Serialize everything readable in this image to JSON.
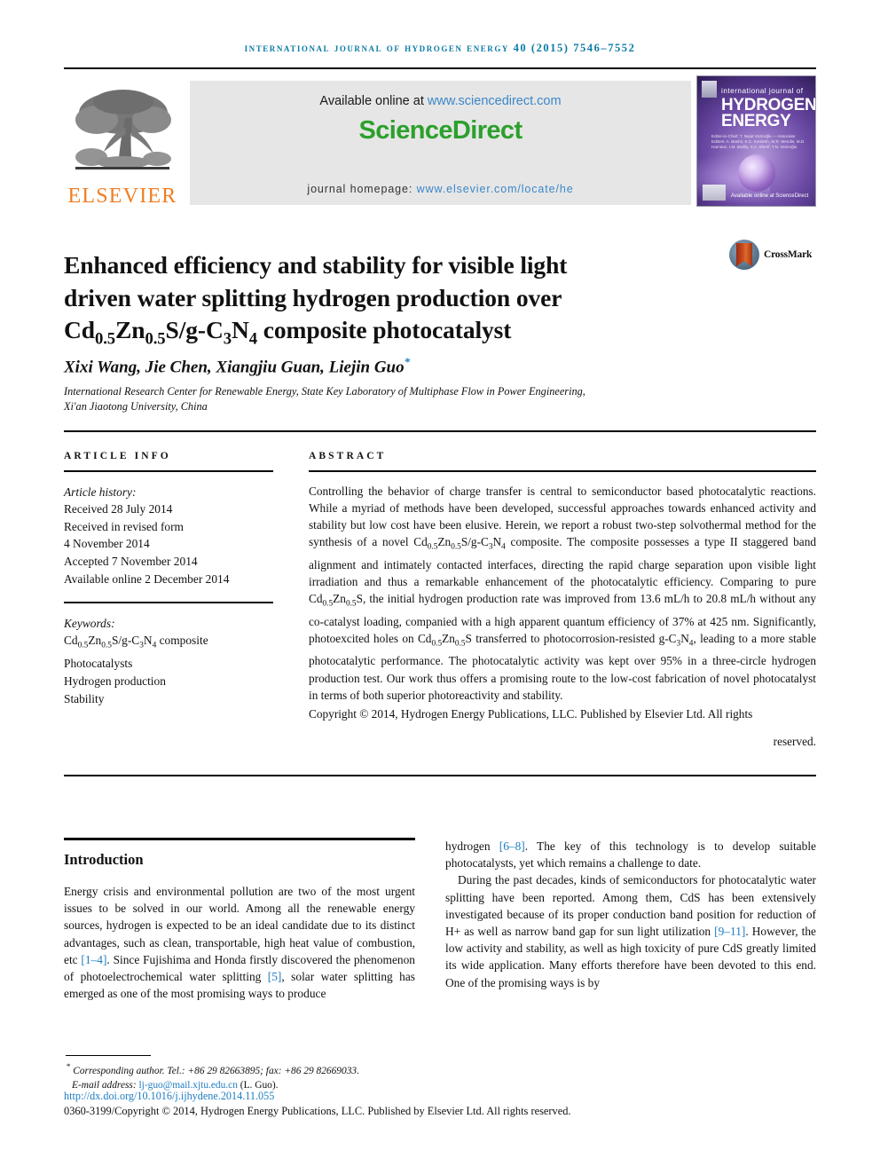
{
  "masthead": {
    "text": "International Journal of Hydrogen Energy 40 (2015) 7546–7552"
  },
  "banner": {
    "elsevier_wordmark": "ELSEVIER",
    "available_prefix": "Available online at ",
    "sciencedirect_url": "www.sciencedirect.com",
    "sciencedirect_logo": "ScienceDirect",
    "homepage_prefix": "journal homepage: ",
    "homepage_url": "www.elsevier.com/locate/he",
    "cover": {
      "line_small": "international journal of",
      "line_big_1": "HYDROGEN",
      "line_big_2": "ENERGY",
      "editors": "Editor-in-Chief: T. Nejat Veziroğlu — Associate Editors: A. Bashir, K.C. Kordesh, M.R. Mendis, M.D. Hamdan, I.M. Bodily, S.A. Sherif, T.N. Veziroğlu",
      "sciencedirect": "Available online at ScienceDirect"
    }
  },
  "article": {
    "title_line_1": "Enhanced efficiency and stability for visible light",
    "title_line_2": "driven water splitting hydrogen production over",
    "title_line_3_pre": "Cd",
    "title_sub_1": "0.5",
    "title_line_3_mid": "Zn",
    "title_sub_2": "0.5",
    "title_line_3_mid2": "S/g-C",
    "title_sub_3": "3",
    "title_line_3_mid3": "N",
    "title_sub_4": "4",
    "title_line_3_post": " composite photocatalyst",
    "crossmark_label": "CrossMark",
    "authors": "Xixi Wang, Jie Chen, Xiangjiu Guan, Liejin Guo",
    "corresponding_marker": "*",
    "affiliation_line_1": "International Research Center for Renewable Energy, State Key Laboratory of Multiphase Flow in Power Engineering,",
    "affiliation_line_2": "Xi'an Jiaotong University, China"
  },
  "article_info": {
    "heading": "ARTICLE INFO",
    "history_label": "Article history:",
    "history": [
      "Received 28 July 2014",
      "Received in revised form",
      "4 November 2014",
      "Accepted 7 November 2014",
      "Available online 2 December 2014"
    ],
    "keywords_label": "Keywords:",
    "keywords": [
      "Cd0.5Zn0.5S/g-C3N4 composite",
      "Photocatalysts",
      "Hydrogen production",
      "Stability"
    ]
  },
  "abstract": {
    "heading": "ABSTRACT",
    "paragraph": "Controlling the behavior of charge transfer is central to semiconductor based photocatalytic reactions. While a myriad of methods have been developed, successful approaches towards enhanced activity and stability but low cost have been elusive. Herein, we report a robust two-step solvothermal method for the synthesis of a novel Cd0.5Zn0.5S/g-C3N4 composite. The composite possesses a type II staggered band alignment and intimately contacted interfaces, directing the rapid charge separation upon visible light irradiation and thus a remarkable enhancement of the photocatalytic efficiency. Comparing to pure Cd0.5Zn0.5S, the initial hydrogen production rate was improved from 13.6 mL/h to 20.8 mL/h without any co-catalyst loading, companied with a high apparent quantum efficiency of 37% at 425 nm. Significantly, photoexcited holes on Cd0.5Zn0.5S transferred to photocorrosion-resisted g-C3N4, leading to a more stable photocatalytic performance. The photocatalytic activity was kept over 95% in a three-circle hydrogen production test. Our work thus offers a promising route to the low-cost fabrication of novel photocatalyst in terms of both superior photoreactivity and stability.",
    "copyright": "Copyright © 2014, Hydrogen Energy Publications, LLC. Published by Elsevier Ltd. All rights",
    "copyright_last": "reserved."
  },
  "body": {
    "intro_heading": "Introduction",
    "left_paragraph_pre": "Energy crisis and environmental pollution are two of the most urgent issues to be solved in our world. Among all the renewable energy sources, hydrogen is expected to be an ideal candidate due to its distinct advantages, such as clean, transportable, high heat value of combustion, etc ",
    "ref_1_4": "[1–4]",
    "left_paragraph_mid": ". Since Fujishima and Honda firstly discovered the phenomenon of photoelectrochemical water splitting ",
    "ref_5": "[5]",
    "left_paragraph_post": ", solar water splitting has emerged as one of the most promising ways to produce",
    "right_paragraph_1_pre": "hydrogen ",
    "ref_6_8": "[6–8]",
    "right_paragraph_1_post": ". The key of this technology is to develop suitable photocatalysts, yet which remains a challenge to date.",
    "right_paragraph_2_pre": "During the past decades, kinds of semiconductors for photocatalytic water splitting have been reported. Among them, CdS has been extensively investigated because of its proper conduction band position for reduction of H+ as well as narrow band gap for sun light utilization ",
    "ref_9_11": "[9–11]",
    "right_paragraph_2_post": ". However, the low activity and stability, as well as high toxicity of pure CdS greatly limited its wide application. Many efforts therefore have been devoted to this end. One of the promising ways is by"
  },
  "footer": {
    "corresponding_star": "*",
    "corresponding": "Corresponding author. Tel.: +86 29 82663895; fax: +86 29 82669033.",
    "email_label": "E-mail address: ",
    "email": "lj-guo@mail.xjtu.edu.cn",
    "email_suffix": " (L. Guo).",
    "doi": "http://dx.doi.org/10.1016/j.ijhydene.2014.11.055",
    "issn_copyright": "0360-3199/Copyright © 2014, Hydrogen Energy Publications, LLC. Published by Elsevier Ltd. All rights reserved."
  },
  "colors": {
    "link_blue": "#1e7cc0",
    "masthead_teal": "#0b7aa5",
    "elsevier_orange": "#f07d22",
    "sciencedirect_green": "#2ca02c",
    "sd_link_blue": "#3a87c8"
  }
}
